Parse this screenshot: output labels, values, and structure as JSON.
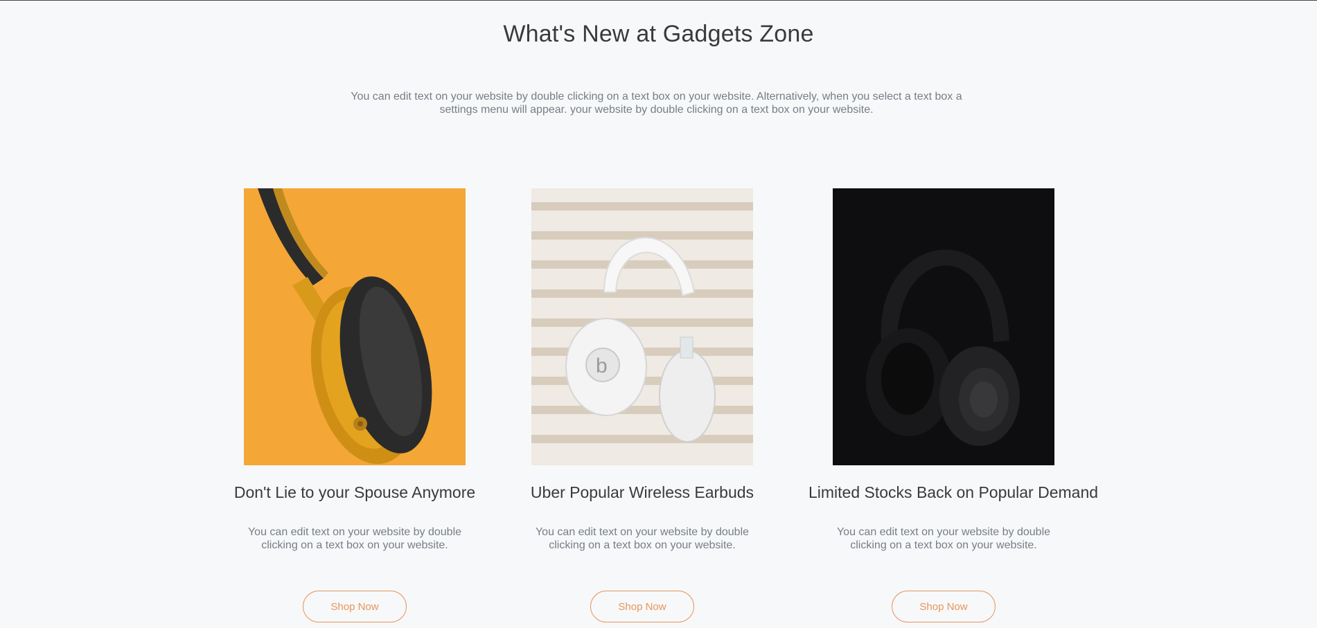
{
  "section": {
    "heading": "What's New at Gadgets Zone",
    "intro": "You can edit text on your website by double clicking on a text box on your website. Alternatively, when you select a text box a settings menu will appear. your website by double clicking on a text box on your website."
  },
  "cards": [
    {
      "title": "Don't Lie to your Spouse Anymore",
      "description": "You can edit text on your website by double clicking on a text box on your website.",
      "button_label": "Shop Now",
      "image_icon": "orange-headphones-image"
    },
    {
      "title": "Uber Popular Wireless Earbuds",
      "description": "You can edit text on your website by double clicking on a text box on your website.",
      "button_label": "Shop Now",
      "image_icon": "white-headphones-image"
    },
    {
      "title": "Limited Stocks Back on Popular Demand",
      "description": "You can edit text on your website by double clicking on a text box on your website.",
      "button_label": "Shop Now",
      "image_icon": "black-headphones-image"
    }
  ],
  "colors": {
    "background": "#f7f8fa",
    "accent": "#e8955a",
    "heading": "#3a3a3a",
    "body_text": "#777d85"
  }
}
